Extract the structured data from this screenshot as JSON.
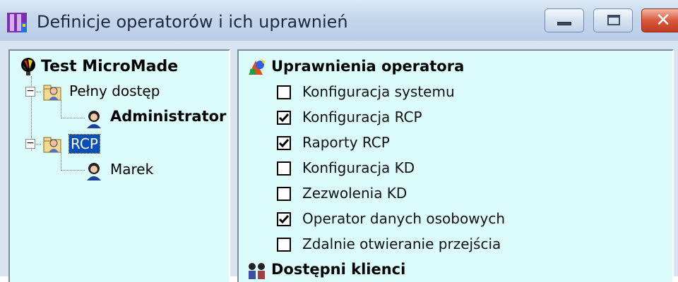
{
  "window": {
    "title": "Definicje operatorów i ich uprawnień"
  },
  "tree": {
    "root": {
      "label": "Test MicroMade"
    },
    "groups": [
      {
        "label": "Pełny dostęp",
        "expanded": true,
        "children": [
          {
            "label": "Administrator",
            "bold": true
          }
        ]
      },
      {
        "label": "RCP",
        "expanded": true,
        "selected": true,
        "children": [
          {
            "label": "Marek",
            "bold": false
          }
        ]
      }
    ]
  },
  "permissions": {
    "header": "Uprawnienia operatora",
    "items": [
      {
        "label": "Konfiguracja systemu",
        "checked": false
      },
      {
        "label": "Konfiguracja RCP",
        "checked": true
      },
      {
        "label": "Raporty RCP",
        "checked": true
      },
      {
        "label": "Konfiguracja KD",
        "checked": false
      },
      {
        "label": "Zezwolenia KD",
        "checked": false
      },
      {
        "label": "Operator danych osobowych",
        "checked": true
      },
      {
        "label": "Zdalnie otwieranie przejścia",
        "checked": false
      }
    ],
    "clients_header": "Dostępni klienci"
  },
  "colors": {
    "panel_bg": "#dcfcfc",
    "selection": "#0a4fb5",
    "close_button": "#c13b1f"
  }
}
